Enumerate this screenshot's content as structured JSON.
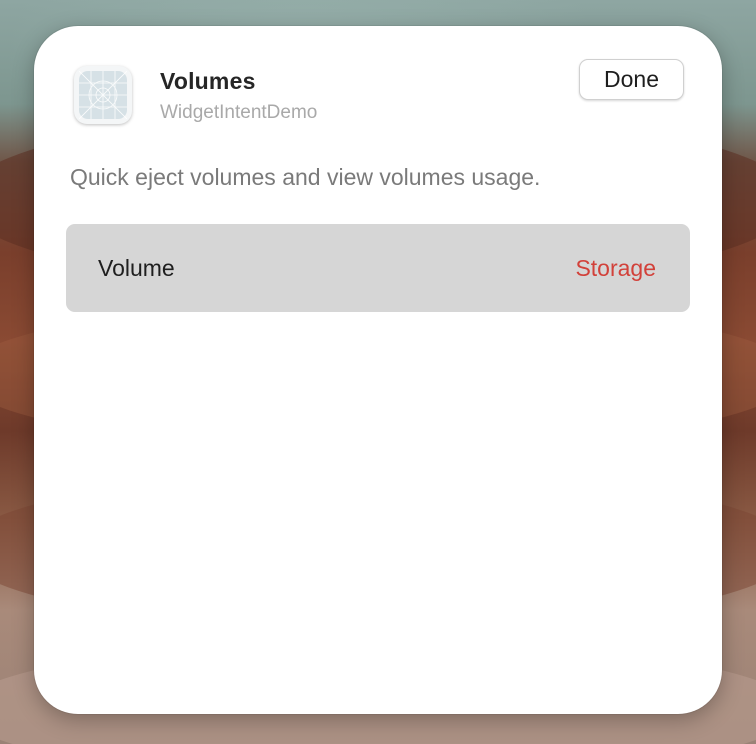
{
  "widget": {
    "title": "Volumes",
    "subtitle": "WidgetIntentDemo",
    "description": "Quick eject volumes and view volumes usage.",
    "done_label": "Done",
    "app_icon": "app-placeholder-icon"
  },
  "parameter": {
    "label": "Volume",
    "value": "Storage"
  },
  "colors": {
    "accent_value": "#d2413a",
    "row_background": "#d6d6d6",
    "panel_background": "#ffffff"
  }
}
